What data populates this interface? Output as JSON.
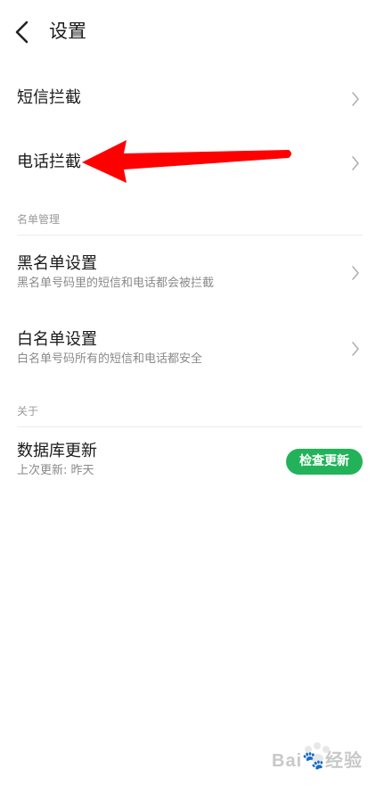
{
  "header": {
    "back_icon": "chevron-left-icon",
    "title": "设置"
  },
  "rows": {
    "sms_block": {
      "title": "短信拦截"
    },
    "call_block": {
      "title": "电话拦截"
    }
  },
  "sections": {
    "list_management": {
      "label": "名单管理",
      "blacklist": {
        "title": "黑名单设置",
        "subtitle": "黑名单号码里的短信和电话都会被拦截"
      },
      "whitelist": {
        "title": "白名单设置",
        "subtitle": "白名单号码所有的短信和电话都安全"
      }
    },
    "about": {
      "label": "关于",
      "database": {
        "title": "数据库更新",
        "subtitle": "上次更新: 昨天",
        "button_label": "检查更新"
      }
    }
  },
  "colors": {
    "accent_green": "#22b35a",
    "annotation_red": "#ff0000"
  },
  "watermark": {
    "text": "Bai🐾经验"
  }
}
